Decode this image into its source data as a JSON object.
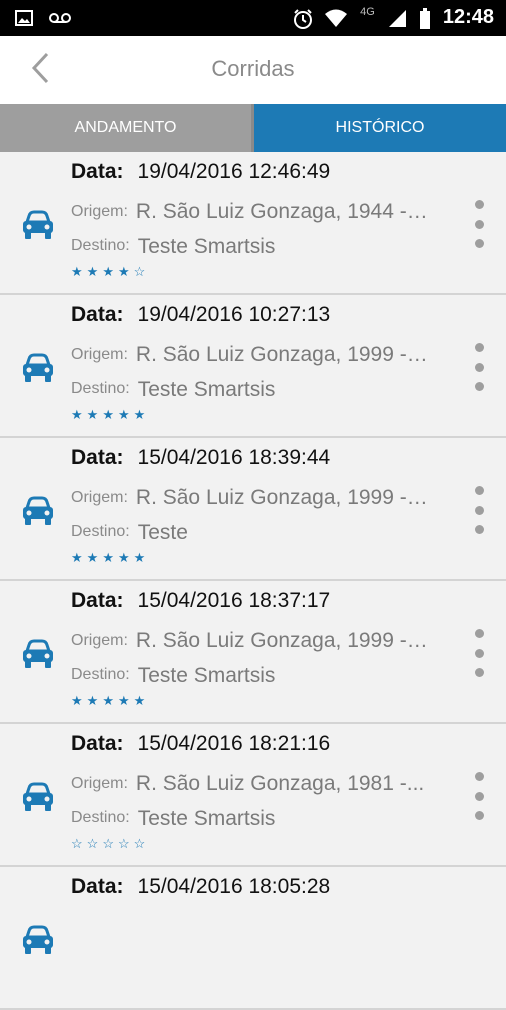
{
  "status_bar": {
    "time": "12:48",
    "network": "4G",
    "icons": [
      "image-icon",
      "voicemail-icon",
      "alarm-icon",
      "wifi-icon",
      "signal-icon",
      "battery-icon"
    ]
  },
  "header": {
    "title": "Corridas",
    "back_icon": "chevron-left-icon"
  },
  "tabs": [
    {
      "label": "ANDAMENTO",
      "active": false
    },
    {
      "label": "HISTÓRICO",
      "active": true
    }
  ],
  "colors": {
    "accent": "#1d7ab5",
    "tab_inactive": "#9e9e9e",
    "background": "#f2f2f2"
  },
  "labels": {
    "date": "Data:",
    "origin": "Origem:",
    "destination": "Destino:"
  },
  "rides": [
    {
      "date": "19/04/2016 12:46:49",
      "origin": "R. São Luiz Gonzaga, 1944 - ...",
      "destination": "Teste Smartsis",
      "rating": 4
    },
    {
      "date": "19/04/2016 10:27:13",
      "origin": "R. São Luiz Gonzaga, 1999 - ...",
      "destination": "Teste Smartsis",
      "rating": 5
    },
    {
      "date": "15/04/2016 18:39:44",
      "origin": "R. São Luiz Gonzaga, 1999 - ...",
      "destination": "Teste",
      "rating": 5
    },
    {
      "date": "15/04/2016 18:37:17",
      "origin": "R. São Luiz Gonzaga, 1999 - ...",
      "destination": "Teste Smartsis",
      "rating": 5
    },
    {
      "date": "15/04/2016 18:21:16",
      "origin": "R. São Luiz Gonzaga, 1981 -...",
      "destination": "Teste Smartsis",
      "rating": 0
    },
    {
      "date": "15/04/2016 18:05:28",
      "origin": "",
      "destination": "",
      "rating": null
    }
  ]
}
